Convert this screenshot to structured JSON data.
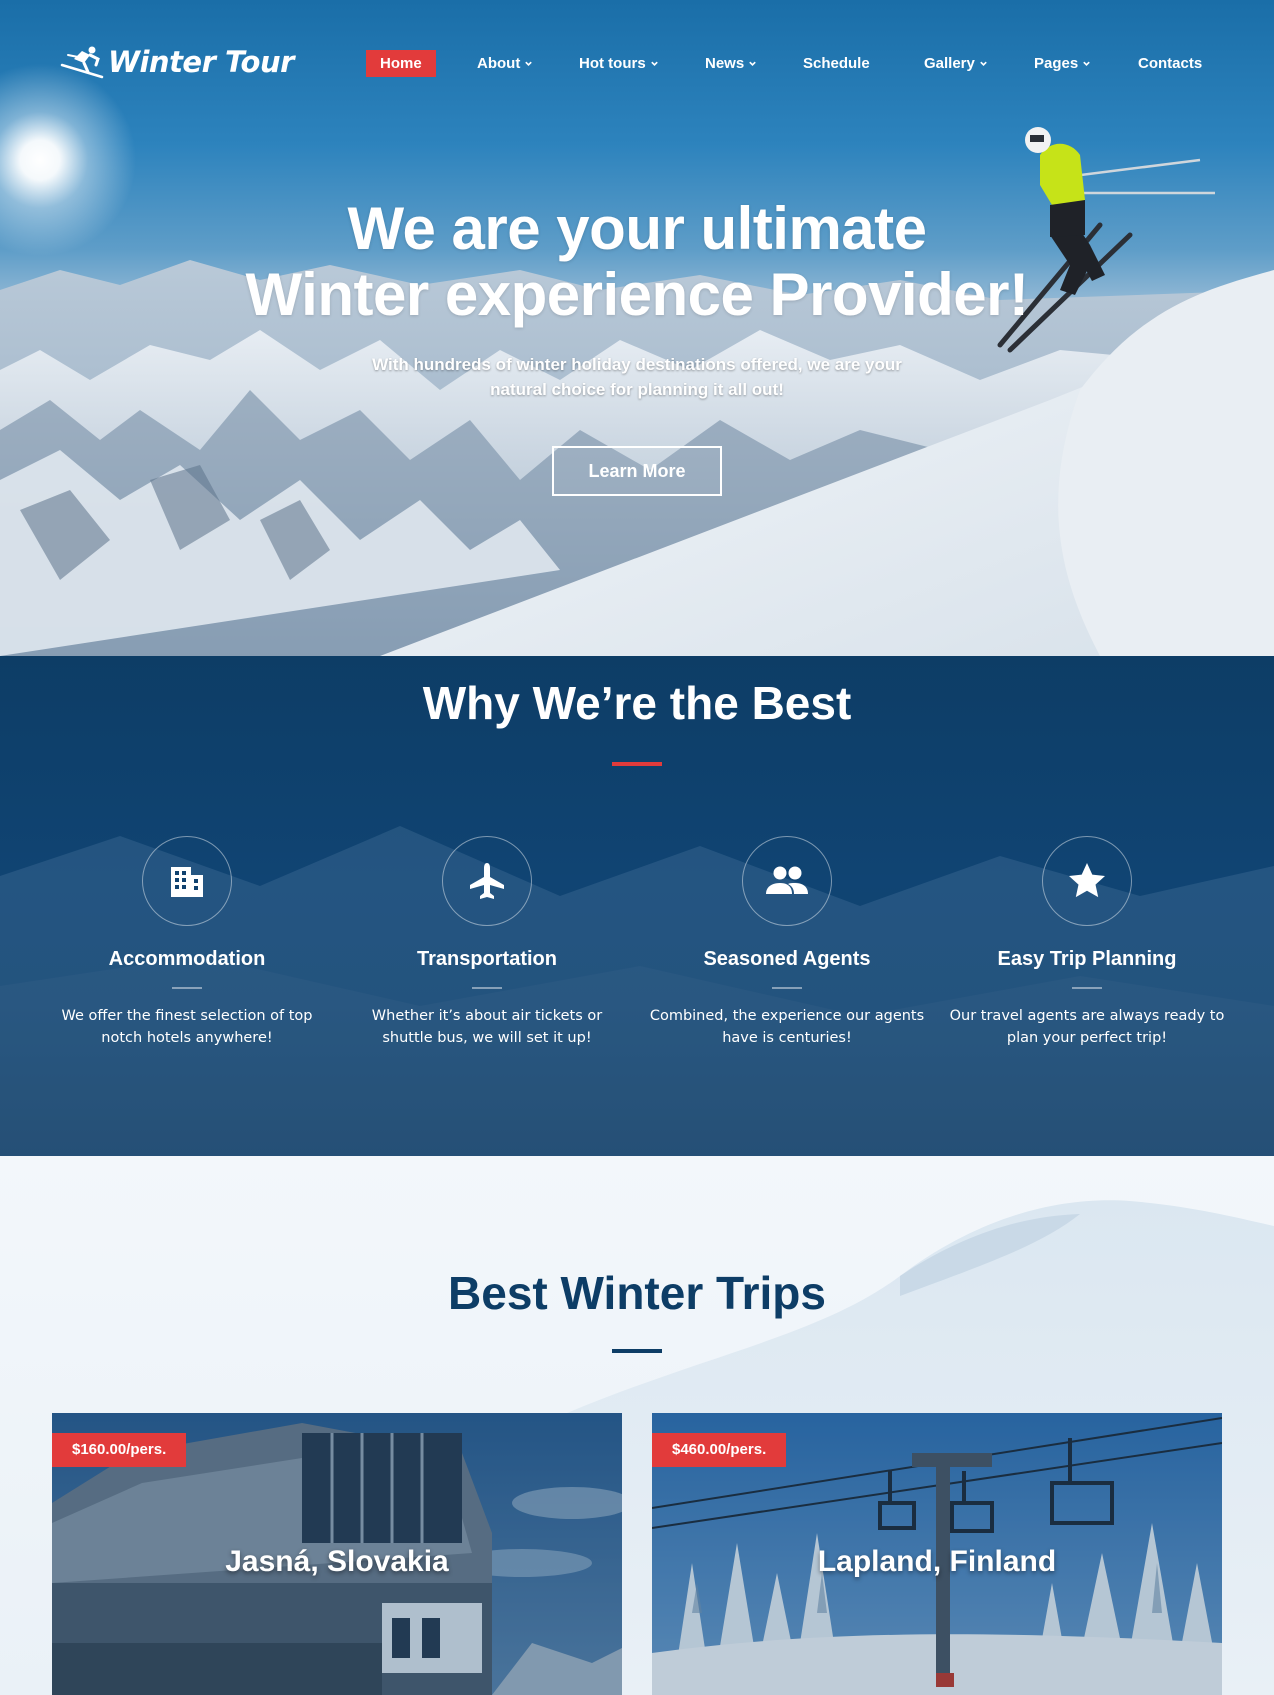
{
  "brand": {
    "name": "Winter Tour"
  },
  "nav": {
    "items": [
      {
        "label": "Home",
        "active": true,
        "dropdown": false
      },
      {
        "label": "About",
        "dropdown": true
      },
      {
        "label": "Hot tours",
        "dropdown": true
      },
      {
        "label": "News",
        "dropdown": true
      },
      {
        "label": "Schedule",
        "dropdown": false
      },
      {
        "label": "Gallery",
        "dropdown": true
      },
      {
        "label": "Pages",
        "dropdown": true
      },
      {
        "label": "Contacts",
        "dropdown": false
      }
    ]
  },
  "hero": {
    "title_line1": "We are your ultimate",
    "title_line2": "Winter experience Provider!",
    "subtitle": "With hundreds of winter holiday destinations offered, we are your natural choice for planning it all out!",
    "cta_label": "Learn More"
  },
  "why": {
    "title": "Why We’re the Best",
    "features": [
      {
        "icon": "building-icon",
        "title": "Accommodation",
        "text": "We offer the finest selection of top notch hotels anywhere!"
      },
      {
        "icon": "airplane-icon",
        "title": "Transportation",
        "text": "Whether it’s about air tickets or shuttle bus, we will set it up!"
      },
      {
        "icon": "people-icon",
        "title": "Seasoned Agents",
        "text": "Combined, the experience our agents have is centuries!"
      },
      {
        "icon": "star-icon",
        "title": "Easy Trip Planning",
        "text": "Our travel agents are always ready to plan your perfect trip!"
      }
    ]
  },
  "trips": {
    "title": "Best Winter Trips",
    "cards": [
      {
        "price": "$160.00/pers.",
        "title": "Jasná, Slovakia"
      },
      {
        "price": "$460.00/pers.",
        "title": "Lapland, Finland"
      }
    ]
  },
  "colors": {
    "accent": "#e23b3b",
    "navy": "#0d3d66",
    "sky": "#1a6ea8"
  }
}
